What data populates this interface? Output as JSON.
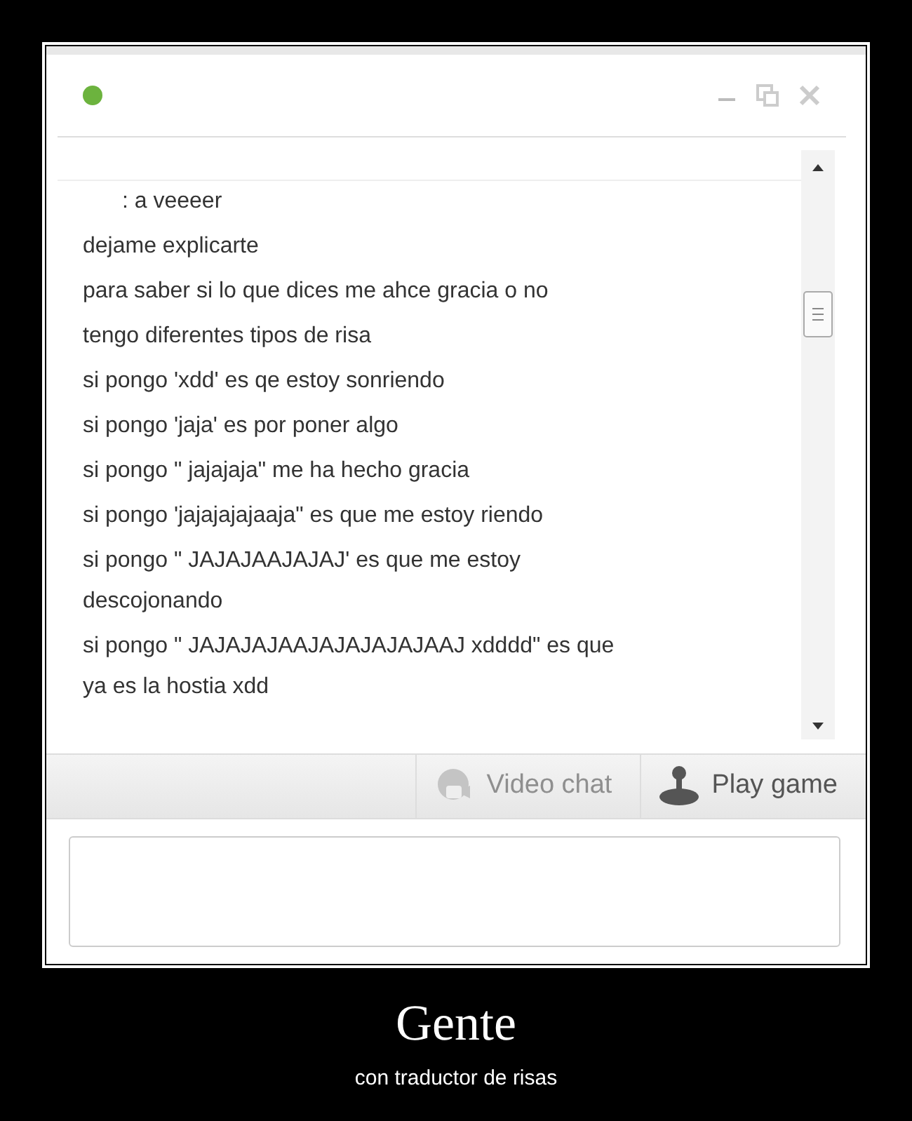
{
  "chat_window": {
    "messages": [
      ": a veeeer",
      "dejame explicarte",
      "para saber si lo que dices me ahce gracia o no",
      "tengo diferentes tipos de risa",
      "si pongo 'xdd' es qe estoy sonriendo",
      "si pongo 'jaja' es por poner algo",
      "si pongo \" jajajaja\" me ha hecho gracia",
      "si pongo 'jajajajajaaja\" es que me estoy riendo",
      "si pongo \" JAJAJAAJAJAJ' es que me estoy descojonando",
      "si pongo \" JAJAJAJAAJAJAJAJAJAAJ xdddd\" es que ya es la hostia xdd"
    ],
    "toolbar": [
      {
        "label": "Video chat",
        "kind": "video",
        "disabled": true
      },
      {
        "label": "Play game",
        "kind": "game",
        "disabled": false
      }
    ]
  },
  "poster": {
    "title": "Gente",
    "caption": "con traductor de risas"
  }
}
